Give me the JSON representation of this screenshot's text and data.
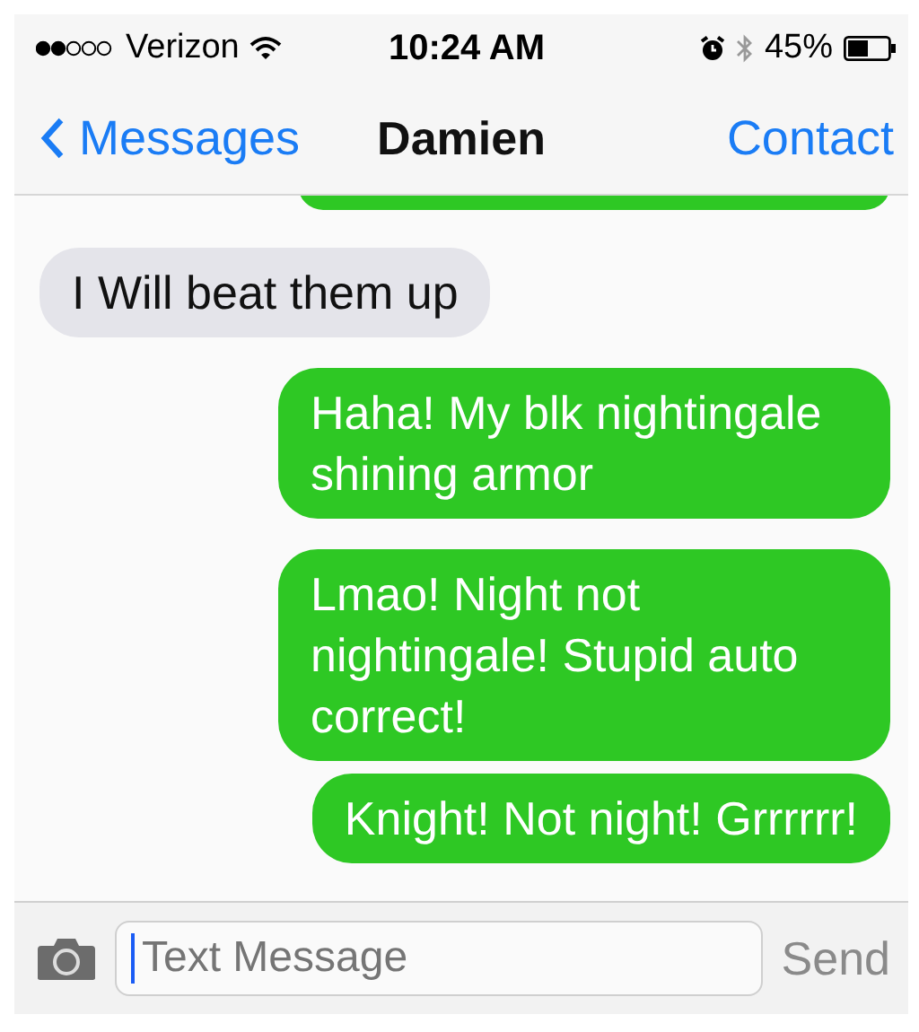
{
  "status_bar": {
    "carrier": "Verizon",
    "time": "10:24 AM",
    "battery": "45%"
  },
  "nav": {
    "back": "Messages",
    "title": "Damien",
    "action": "Contact"
  },
  "messages": [
    {
      "kind": "cut",
      "sent": true
    },
    {
      "kind": "text",
      "sent": false,
      "text": "I Will beat them up"
    },
    {
      "kind": "text",
      "sent": true,
      "text": "Haha! My blk nightingale shining armor"
    },
    {
      "kind": "text",
      "sent": true,
      "text": "Lmao! Night not nightingale! Stupid auto correct!"
    },
    {
      "kind": "text",
      "sent": true,
      "text": "Knight! Not night! Grrrrrr!"
    }
  ],
  "composer": {
    "placeholder": "Text Message",
    "send": "Send",
    "send_disabled": true
  }
}
